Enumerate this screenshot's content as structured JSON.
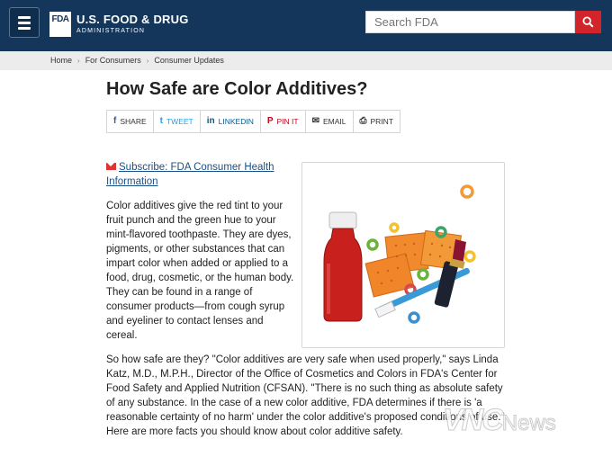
{
  "header": {
    "logo_mark": "FDA",
    "logo_title": "U.S. FOOD & DRUG",
    "logo_subtitle": "ADMINISTRATION",
    "search_placeholder": "Search FDA"
  },
  "breadcrumb": [
    "Home",
    "For Consumers",
    "Consumer Updates"
  ],
  "page": {
    "title": "How Safe are Color Additives?"
  },
  "share": [
    {
      "label": "SHARE",
      "icon": "facebook-icon",
      "glyph": "f",
      "color": "#3b5998"
    },
    {
      "label": "TWEET",
      "icon": "twitter-icon",
      "glyph": "t",
      "color": "#1da1f2"
    },
    {
      "label": "LINKEDIN",
      "icon": "linkedin-icon",
      "glyph": "in",
      "color": "#0e5a8a"
    },
    {
      "label": "PIN IT",
      "icon": "pinterest-icon",
      "glyph": "P",
      "color": "#bd081c"
    },
    {
      "label": "EMAIL",
      "icon": "email-icon",
      "glyph": "✉",
      "color": "#333333"
    },
    {
      "label": "PRINT",
      "icon": "print-icon",
      "glyph": "⎙",
      "color": "#333333"
    }
  ],
  "subscribe": {
    "label": "Subscribe: FDA Consumer Health Information"
  },
  "content": {
    "paragraph1": "Color additives give the red tint to your fruit punch and the green hue to your mint-flavored toothpaste. They are dyes, pigments, or other substances that can impart color when added or applied to a food, drug, cosmetic, or the human body. They can be found in a range of consumer products—from cough syrup and eyeliner to contact lenses and cereal.",
    "paragraph2": "So how safe are they? \"Color additives are very safe when used properly,\" says Linda Katz, M.D., M.P.H., Director of the Office of Cosmetics and Colors in FDA's Center for Food Safety and Applied Nutrition (CFSAN). \"There is no such thing as absolute safety of any substance. In the case of a new color additive, FDA determines if there is 'a reasonable certainty of no harm' under the color additive's proposed conditions of use.\" Here are more facts you should know about color additive safety."
  },
  "watermark": {
    "brand": "VNC",
    "suffix": "News"
  },
  "colors": {
    "header_bg": "#14365a",
    "search_button": "#d1252b",
    "link": "#1a4f86"
  }
}
